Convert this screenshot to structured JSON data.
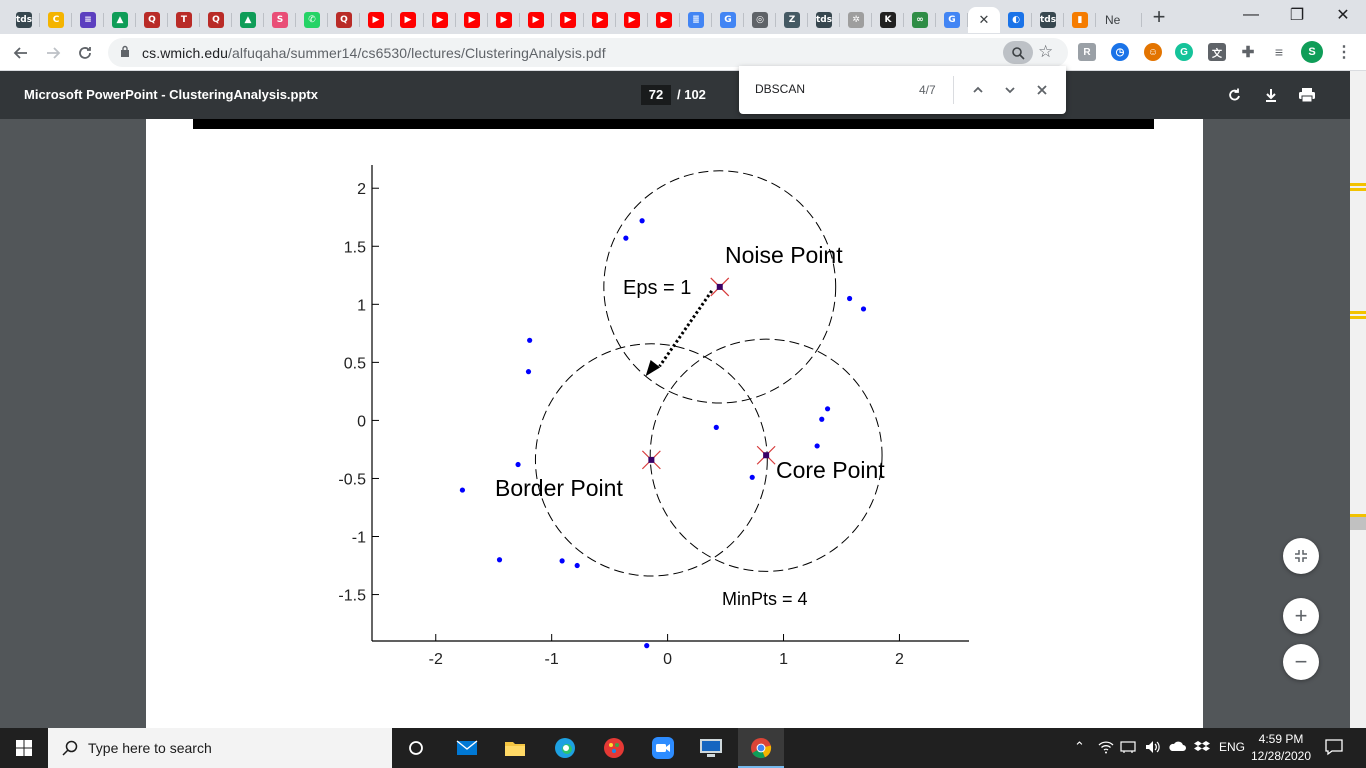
{
  "tabs": [
    {
      "id": "tds1",
      "label": "tds",
      "color": "#37474f"
    },
    {
      "id": "c",
      "label": "C",
      "color": "#f4b400"
    },
    {
      "id": "list",
      "label": "≡",
      "color": "#5c3fbf"
    },
    {
      "id": "drive1",
      "label": "▲",
      "color": "#0f9d58"
    },
    {
      "id": "q1",
      "label": "Q",
      "color": "#b92b27"
    },
    {
      "id": "t",
      "label": "T",
      "color": "#b92b27"
    },
    {
      "id": "q2",
      "label": "Q",
      "color": "#b92b27"
    },
    {
      "id": "drive2",
      "label": "▲",
      "color": "#0f9d58"
    },
    {
      "id": "s",
      "label": "S",
      "color": "#e94e77"
    },
    {
      "id": "wa",
      "label": "✆",
      "color": "#25d366"
    },
    {
      "id": "q3",
      "label": "Q",
      "color": "#b92b27"
    },
    {
      "id": "yt1",
      "label": "▶",
      "color": "#ff0000"
    },
    {
      "id": "yt2",
      "label": "▶",
      "color": "#ff0000"
    },
    {
      "id": "yt3",
      "label": "▶",
      "color": "#ff0000"
    },
    {
      "id": "yt4",
      "label": "▶",
      "color": "#ff0000"
    },
    {
      "id": "yt5",
      "label": "▶",
      "color": "#ff0000"
    },
    {
      "id": "yt6",
      "label": "▶",
      "color": "#ff0000"
    },
    {
      "id": "yt7",
      "label": "▶",
      "color": "#ff0000"
    },
    {
      "id": "yt8",
      "label": "▶",
      "color": "#ff0000"
    },
    {
      "id": "yt9",
      "label": "▶",
      "color": "#ff0000"
    },
    {
      "id": "yt10",
      "label": "▶",
      "color": "#ff0000"
    },
    {
      "id": "docs",
      "label": "≣",
      "color": "#4285f4"
    },
    {
      "id": "g1",
      "label": "G",
      "color": "#4285f4"
    },
    {
      "id": "ring",
      "label": "◎",
      "color": "#5f6368"
    },
    {
      "id": "z",
      "label": "Z",
      "color": "#455a64"
    },
    {
      "id": "tds2",
      "label": "tds",
      "color": "#37474f"
    },
    {
      "id": "gear",
      "label": "✲",
      "color": "#9e9e9e"
    },
    {
      "id": "k",
      "label": "K",
      "color": "#212121"
    },
    {
      "id": "gfg",
      "label": "∞",
      "color": "#2f8d46"
    },
    {
      "id": "g2",
      "label": "G",
      "color": "#4285f4"
    },
    {
      "id": "active",
      "label": "✕",
      "color": "#5f6368"
    },
    {
      "id": "edge",
      "label": "◐",
      "color": "#1a73e8"
    },
    {
      "id": "tds3",
      "label": "tds",
      "color": "#37474f"
    },
    {
      "id": "chart",
      "label": "▮",
      "color": "#f57c00"
    }
  ],
  "last_tab_text": "Ne",
  "new_tab_label": "+",
  "window": {
    "minimize": "—",
    "restore": "❐",
    "close": "✕"
  },
  "address": {
    "host": "cs.wmich.edu",
    "path": "/alfuqaha/summer14/cs6530/lectures/ClusteringAnalysis.pdf"
  },
  "pdf": {
    "title": "Microsoft PowerPoint - ClusteringAnalysis.pptx",
    "page": "72",
    "total": "/ 102"
  },
  "find": {
    "query": "DBSCAN",
    "count": "4/7"
  },
  "slide": {
    "noise_label": "Noise Point",
    "border_label": "Border Point",
    "core_label": "Core Point",
    "eps_label": "Eps = 1",
    "minpts_label": "MinPts = 4",
    "x_ticks": [
      "-2",
      "-1",
      "0",
      "1",
      "2"
    ],
    "y_ticks": [
      "2",
      "1.5",
      "1",
      "0.5",
      "0",
      "-0.5",
      "-1",
      "-1.5"
    ]
  },
  "chart_data": {
    "type": "scatter",
    "xlim": [
      -2.55,
      2.6
    ],
    "ylim": [
      -1.9,
      2.2
    ],
    "x_ticks": [
      -2,
      -1,
      0,
      1,
      2
    ],
    "y_ticks": [
      2,
      1.5,
      1,
      0.5,
      0,
      -0.5,
      -1,
      -1.5
    ],
    "points": [
      [
        -0.22,
        1.72
      ],
      [
        -0.36,
        1.57
      ],
      [
        1.57,
        1.05
      ],
      [
        1.69,
        0.96
      ],
      [
        -1.19,
        0.69
      ],
      [
        -1.2,
        0.42
      ],
      [
        0.42,
        -0.06
      ],
      [
        1.38,
        0.1
      ],
      [
        1.33,
        0.01
      ],
      [
        1.29,
        -0.22
      ],
      [
        -1.29,
        -0.38
      ],
      [
        -1.77,
        -0.6
      ],
      [
        0.73,
        -0.49
      ],
      [
        -1.45,
        -1.2
      ],
      [
        -0.91,
        -1.21
      ],
      [
        -0.78,
        -1.25
      ],
      [
        -0.18,
        -1.94
      ]
    ],
    "special_points": [
      {
        "label": "Noise Point",
        "x": 0.45,
        "y": 1.15
      },
      {
        "label": "Border Point",
        "x": -0.14,
        "y": -0.34
      },
      {
        "label": "Core Point",
        "x": 0.85,
        "y": -0.3
      }
    ],
    "eps": 1
  },
  "taskbar": {
    "search_placeholder": "Type here to search",
    "lang": "ENG",
    "time": "4:59 PM",
    "date": "12/28/2020"
  },
  "colors": {
    "point": "#0000ff",
    "marker": "#d63a3a",
    "accent": "#1a73e8"
  }
}
